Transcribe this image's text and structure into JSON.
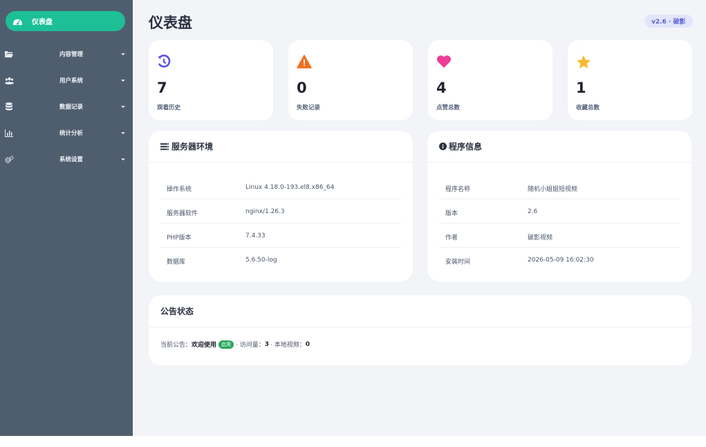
{
  "sidebar": {
    "active": {
      "label": "仪表盘",
      "icon": "dashboard-icon"
    },
    "items": [
      {
        "label": "内容管理",
        "icon": "folder-open-icon"
      },
      {
        "label": "用户系统",
        "icon": "users-icon"
      },
      {
        "label": "数据记录",
        "icon": "database-icon"
      },
      {
        "label": "统计分析",
        "icon": "bar-chart-icon"
      },
      {
        "label": "系统设置",
        "icon": "cogs-icon"
      }
    ]
  },
  "header": {
    "title": "仪表盘",
    "version_badge": "v2.6 · 破影"
  },
  "stats": [
    {
      "value": "7",
      "label": "观看历史",
      "icon": "history-icon",
      "color": "#5a4fe0"
    },
    {
      "value": "0",
      "label": "失败记录",
      "icon": "warning-icon",
      "color": "#f06f1f"
    },
    {
      "value": "4",
      "label": "点赞总数",
      "icon": "heart-icon",
      "color": "#ee3d96"
    },
    {
      "value": "1",
      "label": "收藏总数",
      "icon": "star-icon",
      "color": "#f5b82e"
    }
  ],
  "server": {
    "title": "服务器环境",
    "rows": [
      {
        "key": "操作系统",
        "value": "Linux 4.18.0-193.el8.x86_64"
      },
      {
        "key": "服务器软件",
        "value": "nginx/1.26.3"
      },
      {
        "key": "PHP版本",
        "value": "7.4.33"
      },
      {
        "key": "数据库",
        "value": "5.6.50-log"
      }
    ]
  },
  "program": {
    "title": "程序信息",
    "rows": [
      {
        "key": "程序名称",
        "value": "随机小姐姐短视频"
      },
      {
        "key": "版本",
        "value": "2.6"
      },
      {
        "key": "作者",
        "value": "破影视频"
      },
      {
        "key": "安装时间",
        "value": "2026-05-09 16:02:30"
      }
    ]
  },
  "notice": {
    "title": "公告状态",
    "current_label": "当前公告：",
    "current_value": "欢迎使用",
    "status_badge": "启用",
    "visits_label": "· 访问量：",
    "visits_value": "3",
    "local_videos_label": "· 本地视频：",
    "local_videos_value": "0"
  },
  "colors": {
    "sidebar": "#4f5e6f",
    "accent": "#1dbf97",
    "badge_bg": "#e2e5fb",
    "badge_text": "#5a5fd6",
    "status_green": "#27a85b"
  }
}
